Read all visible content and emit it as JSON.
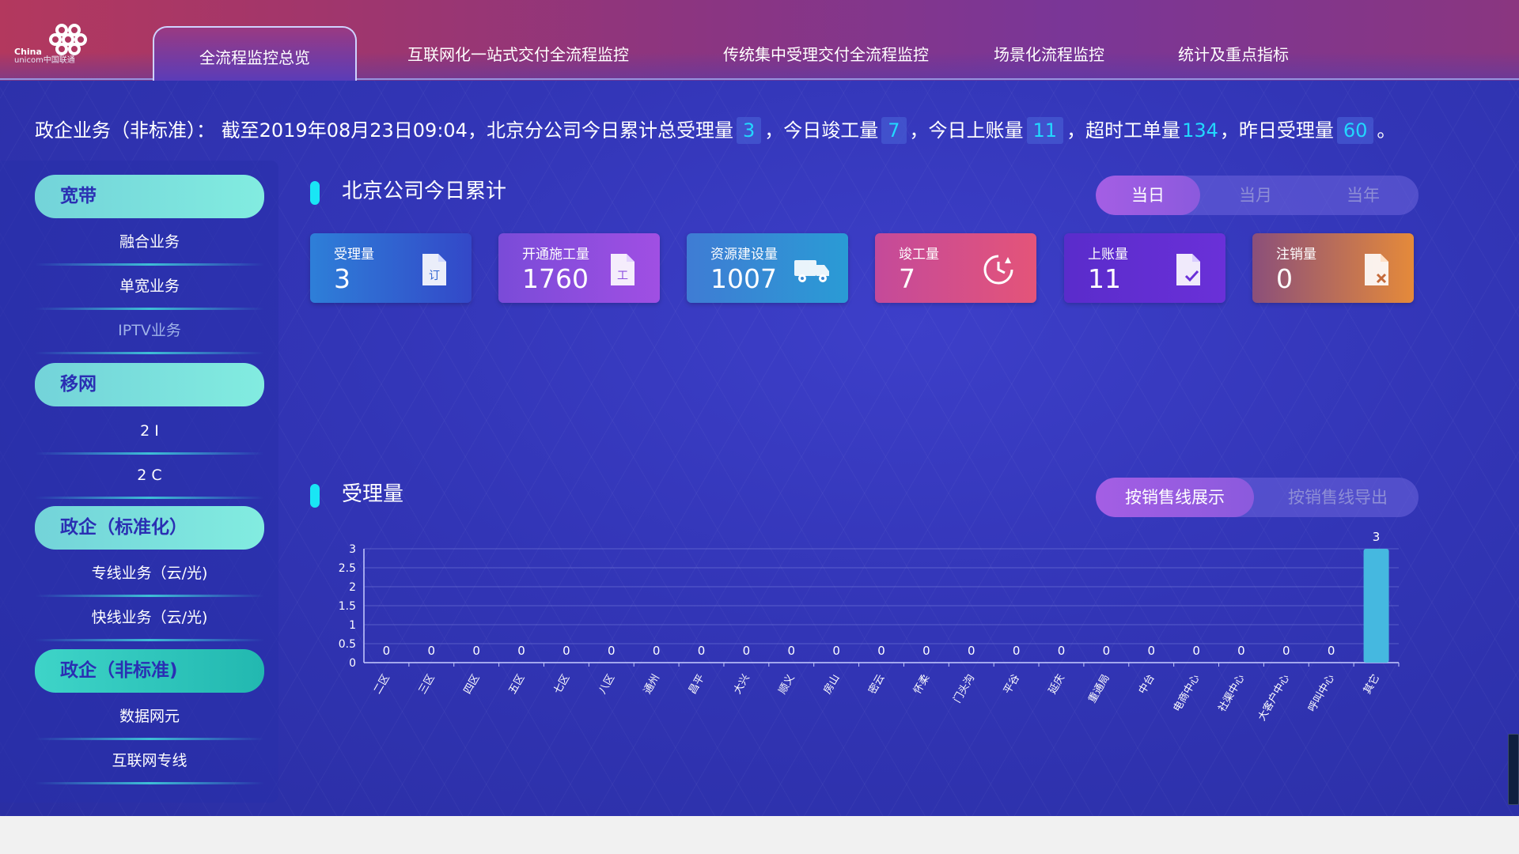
{
  "logo": {
    "line1": "China",
    "line2": "unicom中国联通"
  },
  "tabs": [
    {
      "label": "全流程监控总览",
      "active": true
    },
    {
      "label": "互联网化一站式交付全流程监控"
    },
    {
      "label": "传统集中受理交付全流程监控"
    },
    {
      "label": "场景化流程监控"
    },
    {
      "label": "统计及重点指标"
    }
  ],
  "summary": {
    "prefix": "政企业务（非标准）：  截至2019年08月23日09:04，北京分公司今日累计总受理量",
    "v1": "3",
    "t1": "，今日竣工量",
    "v2": "7",
    "t2": "，今日上账量",
    "v3": "11",
    "t3": "，超时工单量",
    "v4": "134",
    "t4": "，昨日受理量",
    "v5": "60",
    "t5": "。"
  },
  "sidebar": {
    "groups": [
      {
        "title": "宽带",
        "items": [
          "融合业务",
          "单宽业务",
          "IPTV业务"
        ]
      },
      {
        "title": "移网",
        "items": [
          "2 I",
          "2 C"
        ]
      },
      {
        "title": "政企（标准化）",
        "items": [
          "专线业务（云/光)",
          "快线业务（云/光)"
        ]
      },
      {
        "title": "政企（非标准)",
        "items": [
          "数据网元",
          "互联网专线"
        ]
      }
    ]
  },
  "section1": {
    "title": "北京公司今日累计",
    "period_tabs": [
      "当日",
      "当月",
      "当年"
    ],
    "active_period": "当日"
  },
  "cards": [
    {
      "label": "受理量",
      "value": "3",
      "icon": "order-doc-icon",
      "colors": [
        "#2e7fd8",
        "#3348c8"
      ]
    },
    {
      "label": "开通施工量",
      "value": "1760",
      "icon": "work-doc-icon",
      "colors": [
        "#7a4bd8",
        "#a04fe3"
      ]
    },
    {
      "label": "资源建设量",
      "value": "1007",
      "icon": "truck-icon",
      "colors": [
        "#3f7cd4",
        "#2a9bd5"
      ]
    },
    {
      "label": "竣工量",
      "value": "7",
      "icon": "clock-refresh-icon",
      "colors": [
        "#c44a9a",
        "#e45479"
      ]
    },
    {
      "label": "上账量",
      "value": "11",
      "icon": "doc-check-icon",
      "colors": [
        "#5a2ccb",
        "#6a30d8"
      ]
    },
    {
      "label": "注销量",
      "value": "0",
      "icon": "doc-cancel-icon",
      "colors": [
        "#8b4f7a",
        "#e58a3a"
      ]
    }
  ],
  "section2": {
    "title": "受理量",
    "view_tabs": [
      "按销售线展示",
      "按销售线导出"
    ],
    "active_view": "按销售线展示"
  },
  "chart_data": {
    "type": "bar",
    "categories": [
      "二区",
      "三区",
      "四区",
      "五区",
      "七区",
      "八区",
      "通州",
      "昌平",
      "大兴",
      "顺义",
      "房山",
      "密云",
      "怀柔",
      "门头沟",
      "平谷",
      "延庆",
      "重通局",
      "中台",
      "电商中心",
      "社渠中心",
      "大客户中心",
      "呼叫中心",
      "其它"
    ],
    "values": [
      0,
      0,
      0,
      0,
      0,
      0,
      0,
      0,
      0,
      0,
      0,
      0,
      0,
      0,
      0,
      0,
      0,
      0,
      0,
      0,
      0,
      0,
      3
    ],
    "yticks": [
      "0",
      "0.5",
      "1",
      "1.5",
      "2",
      "2.5",
      "3"
    ],
    "ylim": [
      0,
      3
    ],
    "title": "",
    "xlabel": "",
    "ylabel": "",
    "grid": true,
    "bar_color": "#45b8e0"
  }
}
